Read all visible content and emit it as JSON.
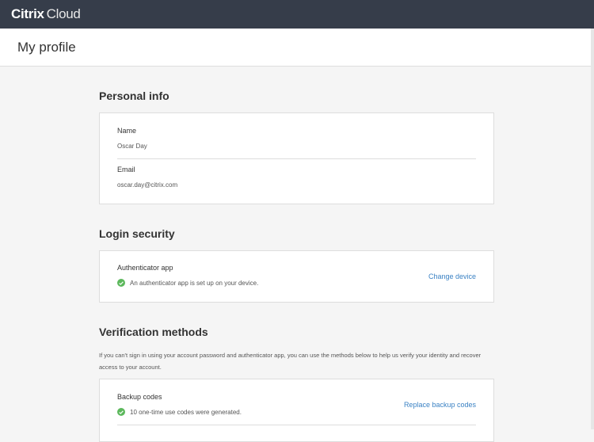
{
  "app": {
    "brand_bold": "Citrix",
    "brand_light": "Cloud"
  },
  "page": {
    "title": "My profile"
  },
  "personal_info": {
    "title": "Personal info",
    "name_label": "Name",
    "name_value": "Oscar Day",
    "email_label": "Email",
    "email_value": "oscar.day@citrix.com"
  },
  "login_security": {
    "title": "Login security",
    "auth_label": "Authenticator app",
    "auth_status": "An authenticator app is set up on your device.",
    "change_link": "Change device"
  },
  "verification": {
    "title": "Verification methods",
    "description": "If you can't sign in using your account password and authenticator app, you can use the methods below to help us verify your identity and recover access to your account.",
    "backup_label": "Backup codes",
    "backup_status": "10 one-time use codes were generated.",
    "replace_link": "Replace backup codes"
  },
  "colors": {
    "header": "#363d4a",
    "accent": "#3b82c4",
    "success": "#5cb85c"
  }
}
